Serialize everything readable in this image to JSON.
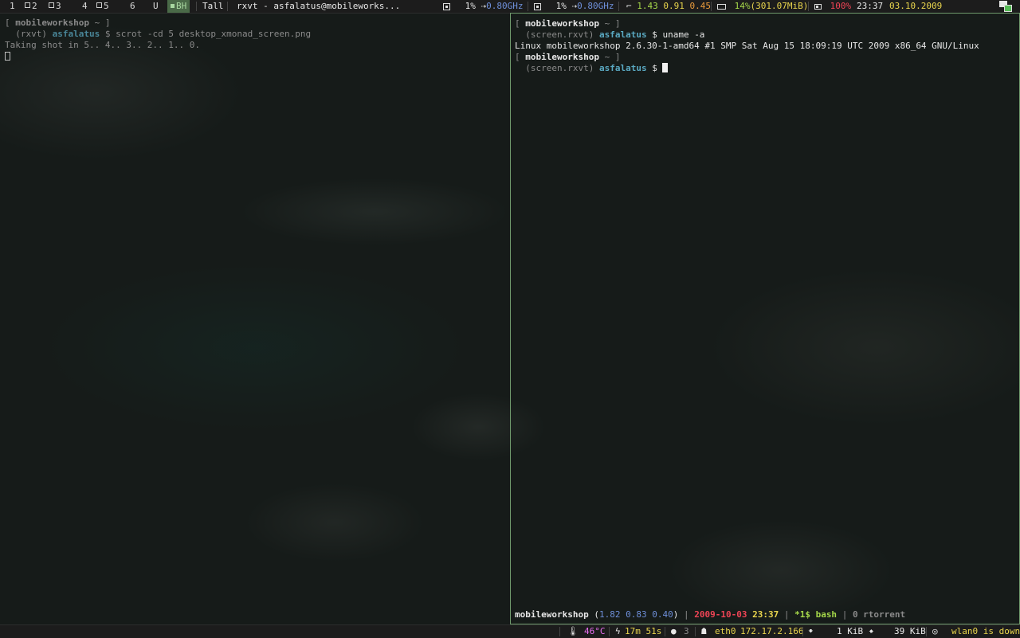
{
  "topbar": {
    "workspaces": [
      {
        "label": "1",
        "has_windows": false
      },
      {
        "label": "2",
        "has_windows": true
      },
      {
        "label": "3",
        "has_windows": true
      },
      {
        "label": "4",
        "has_windows": false
      },
      {
        "label": "5",
        "has_windows": true
      },
      {
        "label": "6",
        "has_windows": false
      },
      {
        "label": "U",
        "has_windows": false
      }
    ],
    "current_workspace": "BH",
    "layout": "Tall",
    "window_title": "rxvt - asfalatus@mobileworks...",
    "cpu1": {
      "usage": "1%",
      "arrow": "⇢",
      "freq": "0.80GHz"
    },
    "cpu2": {
      "usage": "1%",
      "arrow": "⇢",
      "freq": "0.80GHz"
    },
    "load": [
      "1.43",
      "0.91",
      "0.45"
    ],
    "mem": {
      "percent": "14%",
      "used": "(301.07MiB)"
    },
    "battery": "100%",
    "time": "23:37",
    "date": "03.10.2009"
  },
  "left_terminal": {
    "prompt_host": "mobileworkshop",
    "prompt_path": "~",
    "env": "(rxvt)",
    "user": "asfalatus",
    "command": "scrot -cd 5 desktop_xmonad_screen.png",
    "output": "Taking shot in 5.. 4.. 3.. 2.. 1.. 0."
  },
  "right_terminal": {
    "prompt_host": "mobileworkshop",
    "prompt_path": "~",
    "env": "(screen.rxvt)",
    "user": "asfalatus",
    "command": "uname -a",
    "output": "Linux mobileworkshop 2.6.30-1-amd64 #1 SMP Sat Aug 15 18:09:19 UTC 2009 x86_64 GNU/Linux",
    "status": {
      "host": "mobileworkshop",
      "load": [
        "1.82",
        "0.83",
        "0.40"
      ],
      "date": "2009-10-03",
      "time": "23:37",
      "window": "*1$ bash",
      "other": "0 rtorrent"
    }
  },
  "bottombar": {
    "temp": "46°C",
    "uptime": "17m 51s",
    "users": "3",
    "iface": "eth0",
    "ip": "172.17.2.166",
    "down": "1 KiB",
    "up": "39 KiB",
    "wlan": "wlan0 is down"
  }
}
